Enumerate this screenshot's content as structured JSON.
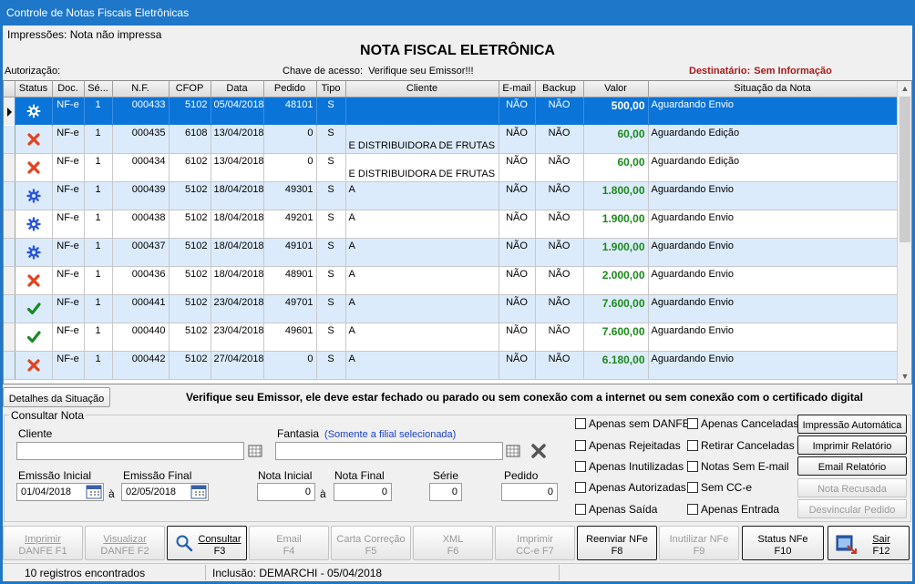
{
  "window": {
    "title": "Controle de Notas Fiscais Eletrônicas"
  },
  "header": {
    "print_status": "Impressões: Nota não impressa",
    "title": "NOTA FISCAL ELETRÔNICA",
    "authorization_label": "Autorização:",
    "access_key_label": "Chave de acesso:",
    "access_key_value": "Verifique seu Emissor!!!",
    "recipient_label": "Destinatário:",
    "recipient_value": "Sem Informação"
  },
  "grid": {
    "columns": [
      "Status",
      "Doc.",
      "Sé...",
      "N.F.",
      "CFOP",
      "Data",
      "Pedido",
      "Tipo",
      "Cliente",
      "E-mail",
      "Backup",
      "Valor",
      "Situação da Nota"
    ],
    "rows": [
      {
        "status": "sending",
        "doc": "NF-e",
        "serie": "1",
        "nf": "000433",
        "cfop": "5102",
        "data": "05/04/2018",
        "pedido": "48101",
        "tipo": "S",
        "cliente": "",
        "cliente2": "",
        "email": "NÃO",
        "backup": "NÃO",
        "valor": "500,00",
        "situacao": "Aguardando Envio"
      },
      {
        "status": "error",
        "doc": "NF-e",
        "serie": "1",
        "nf": "000435",
        "cfop": "6108",
        "data": "13/04/2018",
        "pedido": "0",
        "tipo": "S",
        "cliente": "",
        "cliente2": "E DISTRIBUIDORA DE FRUTAS",
        "email": "NÃO",
        "backup": "NÃO",
        "valor": "60,00",
        "situacao": "Aguardando Edição"
      },
      {
        "status": "error",
        "doc": "NF-e",
        "serie": "1",
        "nf": "000434",
        "cfop": "6102",
        "data": "13/04/2018",
        "pedido": "0",
        "tipo": "S",
        "cliente": "",
        "cliente2": "E DISTRIBUIDORA DE FRUTAS",
        "email": "NÃO",
        "backup": "NÃO",
        "valor": "60,00",
        "situacao": "Aguardando Edição"
      },
      {
        "status": "sending",
        "doc": "NF-e",
        "serie": "1",
        "nf": "000439",
        "cfop": "5102",
        "data": "18/04/2018",
        "pedido": "49301",
        "tipo": "S",
        "cliente": "A",
        "cliente2": "",
        "email": "NÃO",
        "backup": "NÃO",
        "valor": "1.800,00",
        "situacao": "Aguardando Envio"
      },
      {
        "status": "sending",
        "doc": "NF-e",
        "serie": "1",
        "nf": "000438",
        "cfop": "5102",
        "data": "18/04/2018",
        "pedido": "49201",
        "tipo": "S",
        "cliente": "A",
        "cliente2": "",
        "email": "NÃO",
        "backup": "NÃO",
        "valor": "1.900,00",
        "situacao": "Aguardando Envio"
      },
      {
        "status": "sending",
        "doc": "NF-e",
        "serie": "1",
        "nf": "000437",
        "cfop": "5102",
        "data": "18/04/2018",
        "pedido": "49101",
        "tipo": "S",
        "cliente": "A",
        "cliente2": "",
        "email": "NÃO",
        "backup": "NÃO",
        "valor": "1.900,00",
        "situacao": "Aguardando Envio"
      },
      {
        "status": "error",
        "doc": "NF-e",
        "serie": "1",
        "nf": "000436",
        "cfop": "5102",
        "data": "18/04/2018",
        "pedido": "48901",
        "tipo": "S",
        "cliente": "A",
        "cliente2": "",
        "email": "NÃO",
        "backup": "NÃO",
        "valor": "2.000,00",
        "situacao": "Aguardando Envio"
      },
      {
        "status": "ok",
        "doc": "NF-e",
        "serie": "1",
        "nf": "000441",
        "cfop": "5102",
        "data": "23/04/2018",
        "pedido": "49701",
        "tipo": "S",
        "cliente": "A",
        "cliente2": "",
        "email": "NÃO",
        "backup": "NÃO",
        "valor": "7.600,00",
        "situacao": "Aguardando Envio"
      },
      {
        "status": "ok",
        "doc": "NF-e",
        "serie": "1",
        "nf": "000440",
        "cfop": "5102",
        "data": "23/04/2018",
        "pedido": "49601",
        "tipo": "S",
        "cliente": "A",
        "cliente2": "",
        "email": "NÃO",
        "backup": "NÃO",
        "valor": "7.600,00",
        "situacao": "Aguardando Envio"
      },
      {
        "status": "error",
        "doc": "NF-e",
        "serie": "1",
        "nf": "000442",
        "cfop": "5102",
        "data": "27/04/2018",
        "pedido": "0",
        "tipo": "S",
        "cliente": "A",
        "cliente2": "",
        "email": "NÃO",
        "backup": "NÃO",
        "valor": "6.180,00",
        "situacao": "Aguardando Envio"
      }
    ]
  },
  "details_button": "Detalhes da Situação",
  "warning": "Verifique seu Emissor, ele deve estar fechado ou parado ou sem conexão com a internet ou sem conexão com o certificado digital",
  "query": {
    "group_title": "Consultar Nota",
    "cliente_label": "Cliente",
    "cliente_value": "",
    "fantasia_label": "Fantasia",
    "fantasia_note": "(Somente a filial selecionada)",
    "fantasia_value": "",
    "emissao_inicial_label": "Emissão Inicial",
    "emissao_inicial_value": "01/04/2018",
    "emissao_final_label": "Emissão Final",
    "emissao_final_value": "02/05/2018",
    "range_sep": "à",
    "nota_inicial_label": "Nota Inicial",
    "nota_inicial_value": "0",
    "nota_final_label": "Nota Final",
    "nota_final_value": "0",
    "serie_label": "Série",
    "serie_value": "0",
    "pedido_label": "Pedido",
    "pedido_value": "0"
  },
  "filters": {
    "col1": [
      "Apenas sem DANFE",
      "Apenas Rejeitadas",
      "Apenas Inutilizadas",
      "Apenas Autorizadas",
      "Apenas Saída"
    ],
    "col2": [
      "Apenas Canceladas",
      "Retirar Canceladas",
      "Notas Sem E-mail",
      "Sem CC-e",
      "Apenas Entrada"
    ]
  },
  "actions": [
    "Impressão Automática",
    "Imprimir Relatório",
    "Email Relatório",
    "Nota Recusada",
    "Desvincular Pedido"
  ],
  "toolbar": [
    {
      "l1": "Imprimir",
      "l2": "DANFE F1"
    },
    {
      "l1": "Visualizar",
      "l2": "DANFE F2"
    },
    {
      "l1": "Consultar",
      "l2": "F3"
    },
    {
      "l1": "Email",
      "l2": "F4"
    },
    {
      "l1": "Carta Correção",
      "l2": "F5"
    },
    {
      "l1": "XML",
      "l2": "F6"
    },
    {
      "l1": "Imprimir",
      "l2": "CC-e F7"
    },
    {
      "l1": "Reenviar NFe",
      "l2": "F8"
    },
    {
      "l1": "Inutilizar NFe",
      "l2": "F9"
    },
    {
      "l1": "Status NFe",
      "l2": "F10"
    },
    {
      "l1": "Sair",
      "l2": "F12"
    }
  ],
  "statusbar": {
    "records": "10 registros encontrados",
    "inclusion": "Inclusão: DEMARCHI - 05/04/2018"
  },
  "colors": {
    "titlebar": "#1e77c9",
    "selected_row": "#0a74d9",
    "alt_row": "#dcebfc",
    "value_green": "#1b8a1b",
    "recipient_red": "#a61c1c"
  }
}
